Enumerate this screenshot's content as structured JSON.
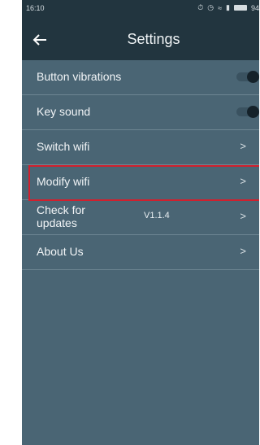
{
  "status_bar": {
    "time": "16:10",
    "battery": "94"
  },
  "header": {
    "title": "Settings"
  },
  "settings": [
    {
      "label": "Button vibrations",
      "control": "toggle",
      "on": true
    },
    {
      "label": "Key sound",
      "control": "toggle",
      "on": true
    },
    {
      "label": "Switch wifi",
      "control": "chevron",
      "chevron": ">"
    },
    {
      "label": "Modify wifi",
      "control": "chevron",
      "chevron": ">",
      "highlighted": true
    },
    {
      "label": "Check for updates",
      "value": "V1.1.4",
      "control": "chevron",
      "chevron": ">"
    },
    {
      "label": "About Us",
      "control": "chevron",
      "chevron": ">"
    }
  ],
  "colors": {
    "header_bg": "#22353f",
    "content_bg": "#4a6574",
    "highlight_border": "#d0202e"
  }
}
